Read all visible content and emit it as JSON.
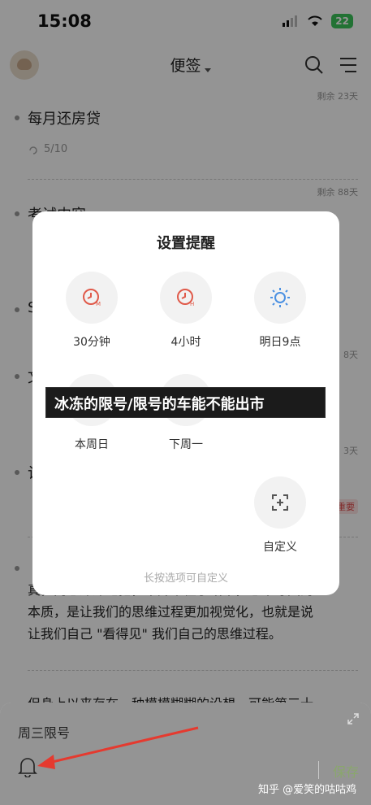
{
  "status_bar": {
    "time": "15:08",
    "battery": "22"
  },
  "header": {
    "title": "便签"
  },
  "notes": [
    {
      "remain": "剩余 23天",
      "title": "每月还房贷",
      "meta": "5/10"
    },
    {
      "remain": "剩余 88天",
      "title": "考试内容"
    },
    {
      "title": "S"
    },
    {
      "remain": "8天",
      "title": "文"
    },
    {
      "remain": "3天",
      "title": "计"
    },
    {
      "tag": "重要"
    }
  ],
  "body_text": {
    "line1": "真，内心深深地把，中并不在乎结果，思维导图的",
    "line2": "本质，是让我们的思维过程更加视觉化，也就是说",
    "line3": "让我们自己 \"看得见\" 我们自己的思维过程。",
    "line4": "但身上以来存在，种模模糊糊的设想，可能第三十"
  },
  "modal": {
    "title": "设置提醒",
    "options": [
      {
        "label": "30分钟",
        "icon": "clock-m-icon"
      },
      {
        "label": "4小时",
        "icon": "clock-h-icon"
      },
      {
        "label": "明日9点",
        "icon": "sun-icon"
      },
      {
        "label": "本周日",
        "icon": "calendar-icon"
      },
      {
        "label": "下周一",
        "icon": "calendar-icon"
      },
      {
        "label": "自定义",
        "icon": "custom-add-icon"
      }
    ],
    "hint": "长按选项可自定义"
  },
  "banner": "冰冻的限号/限号的车能不能出市",
  "bottom_sheet": {
    "text": "周三限号",
    "save": "保存"
  },
  "watermark": "知乎 @爱笑的咕咕鸡",
  "colors": {
    "accent_red": "#e05a4a",
    "save_green": "#8aa76c",
    "battery_green": "#3cc45b"
  }
}
